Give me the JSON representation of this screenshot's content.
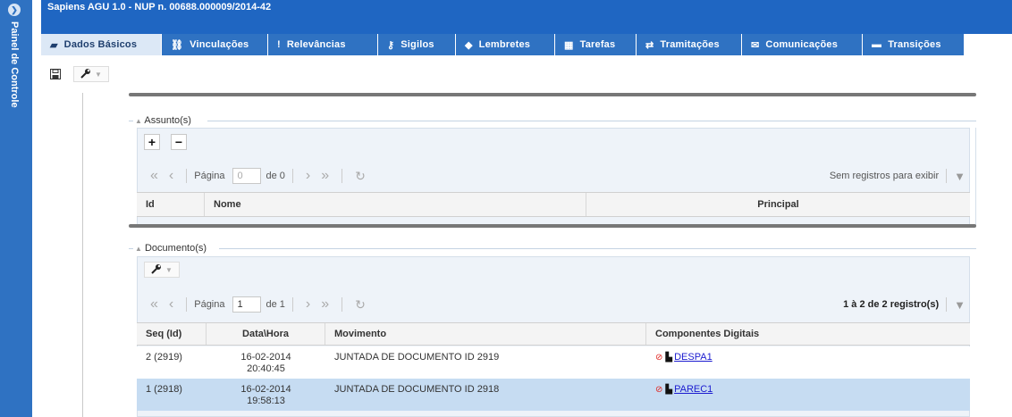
{
  "side_panel": {
    "label": "Painel de Controle",
    "toggle_icon": "chevron-right-icon"
  },
  "window": {
    "title": "Sapiens AGU 1.0 - NUP n. 00688.000009/2014-42"
  },
  "tabs": [
    {
      "label": "Dados Básicos",
      "icon": "book-icon",
      "glyph": "▰",
      "active": true
    },
    {
      "label": "Vinculações",
      "icon": "link-icon",
      "glyph": "⛓"
    },
    {
      "label": "Relevâncias",
      "icon": "exclamation-icon",
      "glyph": "!"
    },
    {
      "label": "Sigilos",
      "icon": "key-icon",
      "glyph": "⚷"
    },
    {
      "label": "Lembretes",
      "icon": "tag-icon",
      "glyph": "◆"
    },
    {
      "label": "Tarefas",
      "icon": "calendar-icon",
      "glyph": "▦"
    },
    {
      "label": "Tramitações",
      "icon": "transfer-icon",
      "glyph": "⇄"
    },
    {
      "label": "Comunicações",
      "icon": "envelope-icon",
      "glyph": "✉"
    },
    {
      "label": "Transições",
      "icon": "archive-icon",
      "glyph": "▬"
    }
  ],
  "toolbar": {
    "save_icon": "save-icon",
    "tools_icon": "wrench-icon"
  },
  "assuntos": {
    "legend": "Assunto(s)",
    "add_label": "+",
    "remove_label": "−",
    "pager": {
      "page_label": "Página",
      "page_value": "0",
      "of_label": "de 0",
      "status": "Sem registros para exibir"
    },
    "columns": [
      "Id",
      "Nome",
      "Principal"
    ]
  },
  "documentos": {
    "legend": "Documento(s)",
    "pager": {
      "page_label": "Página",
      "page_value": "1",
      "of_label": "de 1",
      "status": "1 à 2 de 2 registro(s)"
    },
    "columns": [
      "Seq (Id)",
      "Data\\Hora",
      "Movimento",
      "Componentes Digitais"
    ],
    "rows": [
      {
        "seq": "2 (2919)",
        "date": "16-02-2014",
        "time": "20:40:45",
        "movimento": "JUNTADA DE DOCUMENTO ID 2919",
        "componente": "DESPA1",
        "selected": false
      },
      {
        "seq": "1 (2918)",
        "date": "16-02-2014",
        "time": "19:58:13",
        "movimento": "JUNTADA DE DOCUMENTO ID 2918",
        "componente": "PAREC1",
        "selected": true
      }
    ]
  },
  "colors": {
    "primary": "#2f72c2",
    "title_bar": "#1f66c2",
    "active_tab": "#dce8f6",
    "selected_row": "#c6dcf2",
    "link": "#1b1bcf"
  }
}
